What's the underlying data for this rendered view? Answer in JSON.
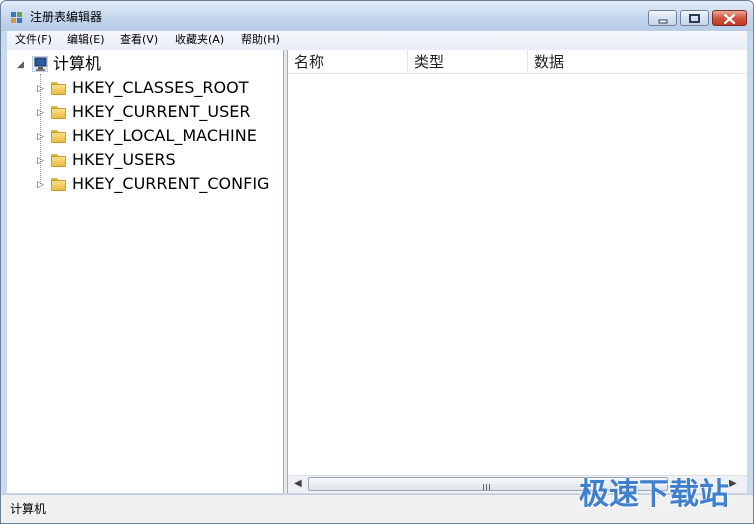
{
  "window": {
    "title": "注册表编辑器"
  },
  "menu": [
    "文件(F)",
    "编辑(E)",
    "查看(V)",
    "收藏夹(A)",
    "帮助(H)"
  ],
  "tree": {
    "root": "计算机",
    "keys": [
      "HKEY_CLASSES_ROOT",
      "HKEY_CURRENT_USER",
      "HKEY_LOCAL_MACHINE",
      "HKEY_USERS",
      "HKEY_CURRENT_CONFIG"
    ]
  },
  "list": {
    "columns": [
      "名称",
      "类型",
      "数据"
    ]
  },
  "status": {
    "text": "计算机"
  },
  "watermark": {
    "text": "极速下载站"
  },
  "colors": {
    "accent": "#c9d9ee",
    "selection": "#cce8ff",
    "close_button": "#c2391f"
  },
  "icons": {
    "app": "registry-editor-icon",
    "root": "computer-icon",
    "key": "folder-icon",
    "expand": "triangle-right-icon",
    "expanded": "triangle-down-icon"
  }
}
